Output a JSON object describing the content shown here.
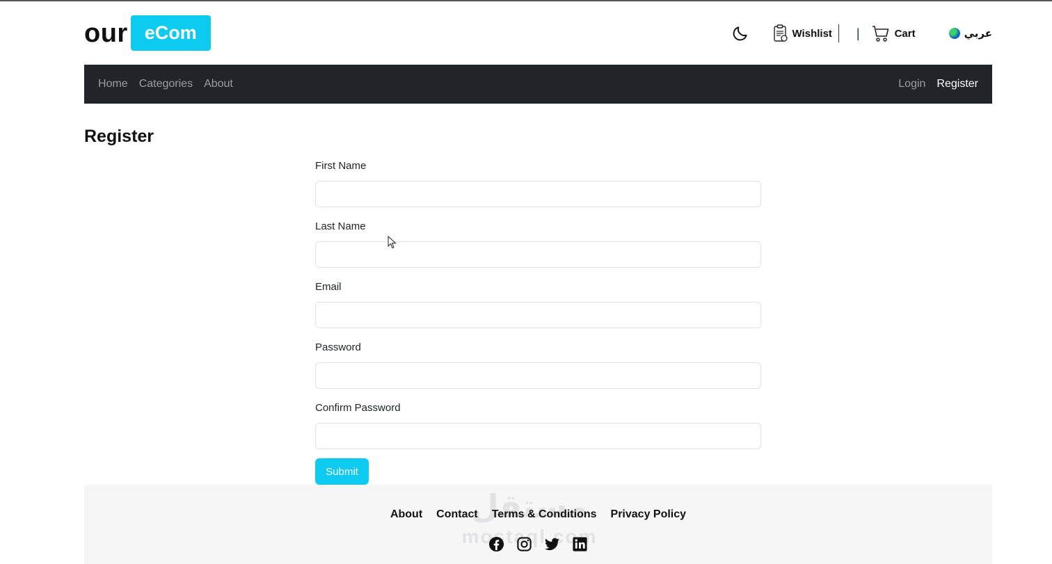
{
  "brand": {
    "part1": "our",
    "part2": "eCom"
  },
  "header": {
    "wishlist_label": "Wishlist",
    "separator": "|",
    "cart_label": "Cart",
    "language_label": "عربي"
  },
  "nav": {
    "left": [
      {
        "label": "Home"
      },
      {
        "label": "Categories"
      },
      {
        "label": "About"
      }
    ],
    "right": [
      {
        "label": "Login"
      },
      {
        "label": "Register"
      }
    ]
  },
  "page": {
    "title": "Register"
  },
  "form": {
    "fields": [
      {
        "label": "First Name",
        "value": ""
      },
      {
        "label": "Last Name",
        "value": ""
      },
      {
        "label": "Email",
        "value": ""
      },
      {
        "label": "Password",
        "value": ""
      },
      {
        "label": "Confirm Password",
        "value": ""
      }
    ],
    "submit_label": "Submit"
  },
  "footer": {
    "links": [
      {
        "label": "About"
      },
      {
        "label": "Contact"
      },
      {
        "label": "Terms & Conditions"
      },
      {
        "label": "Privacy Policy"
      }
    ],
    "socials": [
      "facebook-icon",
      "instagram-icon",
      "twitter-icon",
      "linkedin-icon"
    ],
    "watermark": {
      "arabic": "مستقل",
      "latin": "mostaql.com"
    }
  },
  "colors": {
    "accent": "#0dcaf0",
    "navbar": "#212529",
    "footer": "#f6f6f7"
  }
}
